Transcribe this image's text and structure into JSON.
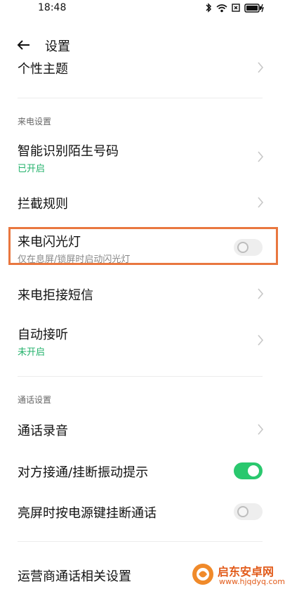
{
  "status": {
    "time": "18:48"
  },
  "header": {
    "title": "设置"
  },
  "items": {
    "theme": {
      "label": "个性主题"
    },
    "call_settings_section": "来电设置",
    "smart_id": {
      "label": "智能识别陌生号码",
      "status": "已开启"
    },
    "intercept": {
      "label": "拦截规则"
    },
    "flash": {
      "label": "来电闪光灯",
      "desc": "仅在息屏/锁屏时启动闪光灯",
      "enabled": false
    },
    "reject_sms": {
      "label": "来电拒接短信"
    },
    "auto_answer": {
      "label": "自动接听",
      "status": "未开启"
    },
    "talk_settings_section": "通话设置",
    "recording": {
      "label": "通话录音"
    },
    "vibrate": {
      "label": "对方接通/挂断振动提示",
      "enabled": true
    },
    "power_hangup": {
      "label": "亮屏时按电源键挂断通话",
      "enabled": false
    },
    "carrier": {
      "label": "运营商通话相关设置"
    }
  },
  "watermark": {
    "name": "启东安卓网",
    "url": "www.hjqdyq.com"
  },
  "colors": {
    "accent_green": "#2ac86e",
    "highlight": "#e9773f"
  }
}
